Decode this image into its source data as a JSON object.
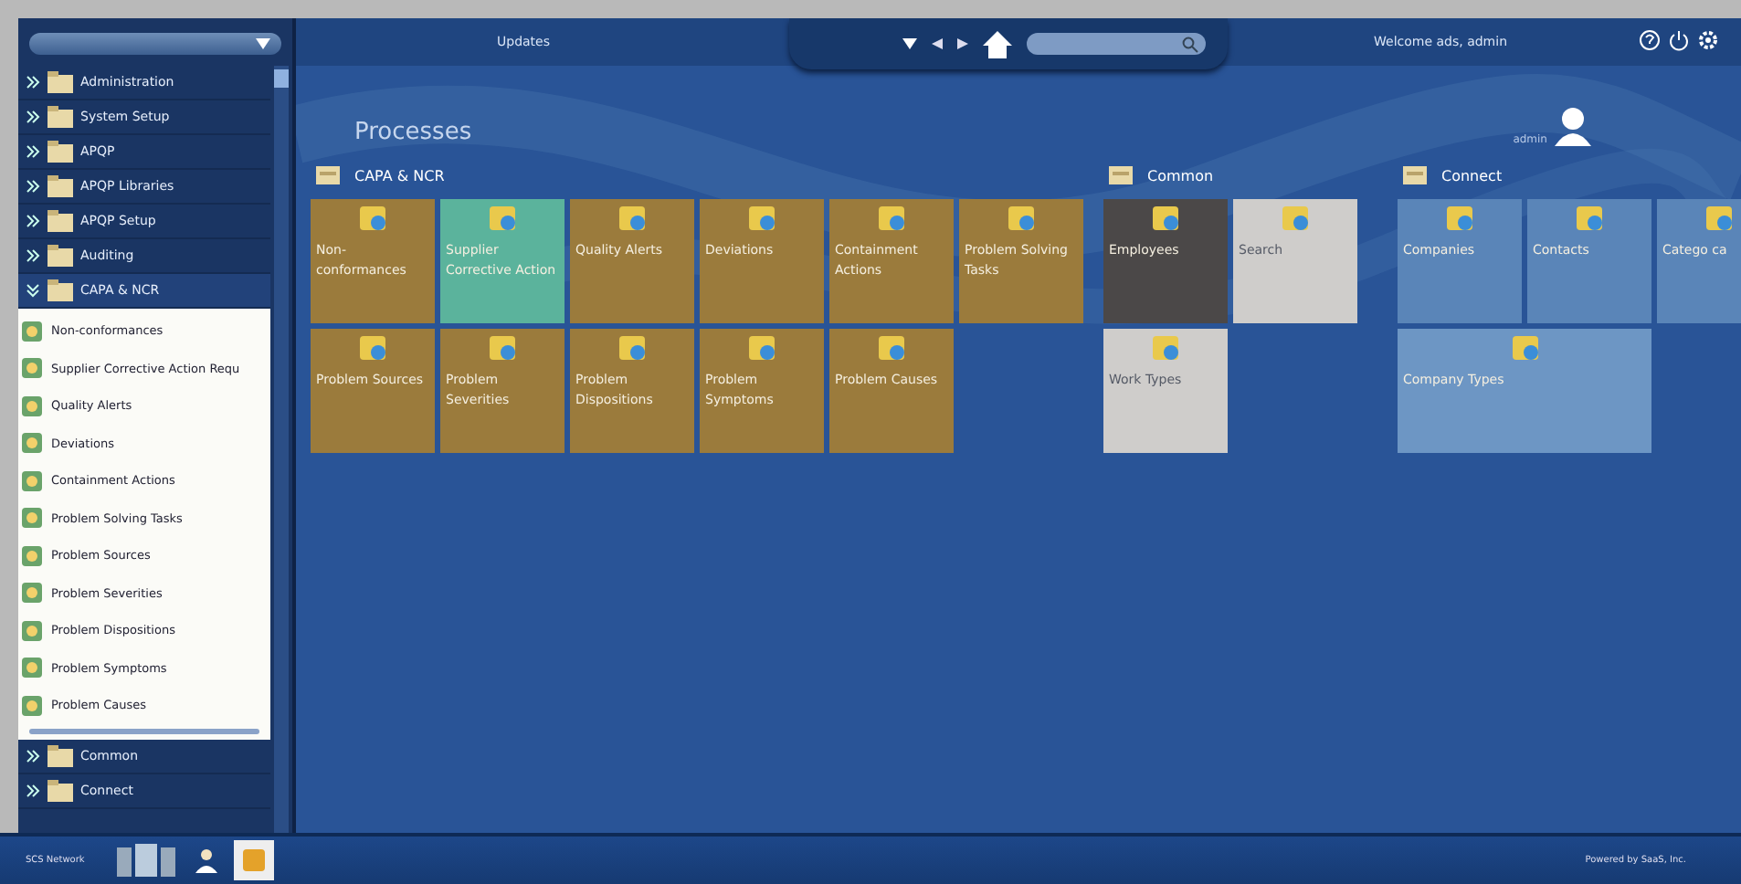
{
  "sidebar": {
    "items": [
      {
        "label": "Administration",
        "expanded": false
      },
      {
        "label": "System Setup",
        "expanded": false
      },
      {
        "label": "APQP",
        "expanded": false
      },
      {
        "label": "APQP Libraries",
        "expanded": false
      },
      {
        "label": "APQP Setup",
        "expanded": false
      },
      {
        "label": "Auditing",
        "expanded": false
      },
      {
        "label": "CAPA & NCR",
        "expanded": true,
        "children": [
          {
            "label": "Non-conformances"
          },
          {
            "label": "Supplier Corrective Action Requ"
          },
          {
            "label": "Quality Alerts"
          },
          {
            "label": "Deviations"
          },
          {
            "label": "Containment Actions"
          },
          {
            "label": "Problem Solving Tasks"
          },
          {
            "label": "Problem Sources"
          },
          {
            "label": "Problem Severities"
          },
          {
            "label": "Problem Dispositions"
          },
          {
            "label": "Problem Symptoms"
          },
          {
            "label": "Problem Causes"
          }
        ]
      },
      {
        "label": "Common",
        "expanded": false
      },
      {
        "label": "Connect",
        "expanded": false
      }
    ]
  },
  "top_bar": {
    "left_text": "Updates",
    "right_text": "Welcome ads, admin"
  },
  "main": {
    "title": "Processes",
    "user": "admin",
    "groups": [
      {
        "title": "CAPA & NCR",
        "tiles": [
          {
            "label": "Non-conformances",
            "color": "#9b7b3c"
          },
          {
            "label": "Supplier Corrective Action",
            "color": "#5bb39c"
          },
          {
            "label": "Quality Alerts",
            "color": "#9b7b3c"
          },
          {
            "label": "Deviations",
            "color": "#9b7b3c"
          },
          {
            "label": "Containment Actions",
            "color": "#9b7b3c"
          },
          {
            "label": "Problem Solving Tasks",
            "color": "#9b7b3c"
          },
          {
            "label": "Problem Sources",
            "color": "#9b7b3c"
          },
          {
            "label": "Problem Severities",
            "color": "#9b7b3c"
          },
          {
            "label": "Problem Dispositions",
            "color": "#9b7b3c"
          },
          {
            "label": "Problem Symptoms",
            "color": "#9b7b3c"
          },
          {
            "label": "Problem Causes",
            "color": "#9b7b3c"
          }
        ]
      },
      {
        "title": "Common",
        "tiles": [
          {
            "label": "Employees",
            "color": "#4b4848"
          },
          {
            "label": "Search",
            "color": "#cfcdcb"
          },
          {
            "label": "Work Types",
            "color": "#cfcdcb"
          }
        ]
      },
      {
        "title": "Connect",
        "tiles": [
          {
            "label": "Companies",
            "color": "#5a85b8"
          },
          {
            "label": "Contacts",
            "color": "#5a85b8"
          },
          {
            "label": "Catego ca",
            "color": "#5a85b8"
          },
          {
            "label": "Company Types",
            "color": "#6d96c4",
            "wide": true
          }
        ]
      }
    ]
  },
  "status_bar": {
    "left_text": "SCS Network",
    "right_text": "Powered by SaaS, Inc."
  }
}
